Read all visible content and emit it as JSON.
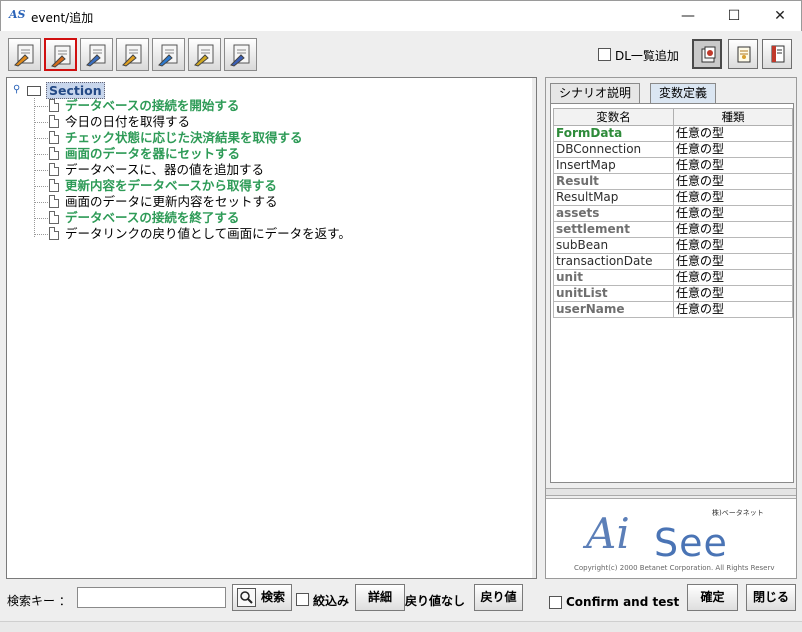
{
  "window": {
    "icon_text": "AS",
    "title": "event/追加",
    "minimize": "—",
    "maximize": "☐",
    "close": "✕"
  },
  "toolbar": {
    "tool_buttons": [
      "tool-1",
      "tool-2",
      "tool-3",
      "tool-4",
      "tool-5",
      "tool-6",
      "tool-7"
    ],
    "selected_index": 1,
    "dl_add_label": "DL一覧追加",
    "dl_add_checked": false
  },
  "tree": {
    "root_label": "Section",
    "items": [
      {
        "label": "データベースの接続を開始する",
        "style": "green"
      },
      {
        "label": "今日の日付を取得する",
        "style": "plain"
      },
      {
        "label": "チェック状態に応じた決済結果を取得する",
        "style": "green"
      },
      {
        "label": "画面のデータを器にセットする",
        "style": "green"
      },
      {
        "label": "データベースに、器の値を追加する",
        "style": "plain"
      },
      {
        "label": "更新内容をデータベースから取得する",
        "style": "green"
      },
      {
        "label": "画面のデータに更新内容をセットする",
        "style": "plain"
      },
      {
        "label": "データベースの接続を終了する",
        "style": "green"
      },
      {
        "label": "データリンクの戻り値として画面にデータを返す。",
        "style": "plain"
      }
    ]
  },
  "right_panel": {
    "tabs": [
      "シナリオ説明",
      "変数定義"
    ],
    "active_tab": 1,
    "columns": [
      "変数名",
      "種類"
    ],
    "variables": [
      {
        "name": "FormData",
        "type": "任意の型",
        "style": "green"
      },
      {
        "name": "DBConnection",
        "type": "任意の型",
        "style": "normal"
      },
      {
        "name": "InsertMap",
        "type": "任意の型",
        "style": "normal"
      },
      {
        "name": "Result",
        "type": "任意の型",
        "style": "gray-bold"
      },
      {
        "name": "ResultMap",
        "type": "任意の型",
        "style": "normal"
      },
      {
        "name": "assets",
        "type": "任意の型",
        "style": "gray-bold"
      },
      {
        "name": "settlement",
        "type": "任意の型",
        "style": "gray-bold"
      },
      {
        "name": "subBean",
        "type": "任意の型",
        "style": "normal"
      },
      {
        "name": "transactionDate",
        "type": "任意の型",
        "style": "normal"
      },
      {
        "name": "unit",
        "type": "任意の型",
        "style": "gray-bold"
      },
      {
        "name": "unitList",
        "type": "任意の型",
        "style": "gray-bold"
      },
      {
        "name": "userName",
        "type": "任意の型",
        "style": "gray-bold"
      }
    ],
    "logo": {
      "tagline": "株)ベータネット",
      "mark_ai": "Ai",
      "mark_see": "See",
      "copyright": "Copyright(c) 2000 Betanet Corporation. All Rights Reserv"
    }
  },
  "bottom": {
    "search_label": "検索キー ：",
    "search_value": "",
    "search_button": "検索",
    "filter_label": "絞込み",
    "detail_button": "詳細",
    "no_return_label": "戻り値なし",
    "return_button": "戻り値",
    "confirm_test_label": "Confirm and test",
    "ok_button": "確定",
    "close_button": "閉じる"
  }
}
